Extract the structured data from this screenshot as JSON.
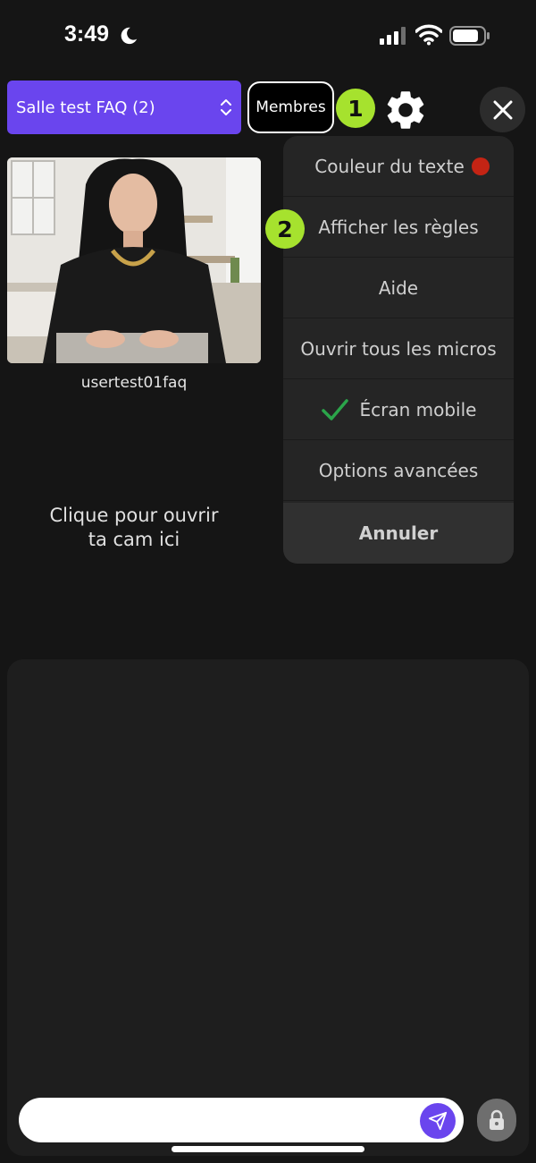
{
  "status_bar": {
    "time": "3:49"
  },
  "header": {
    "room_name": "Salle test FAQ (2)",
    "members_label": "Membres",
    "badge_1": "1",
    "badge_2": "2"
  },
  "video": {
    "username": "usertest01faq"
  },
  "cam_prompt": {
    "line1": "Clique pour ouvrir",
    "line2": "ta cam ici"
  },
  "menu": {
    "items": [
      {
        "label": "Couleur du texte",
        "color": "#c42414"
      },
      {
        "label": "Afficher les règles"
      },
      {
        "label": "Aide"
      },
      {
        "label": "Ouvrir tous les micros"
      },
      {
        "label": "Écran mobile",
        "checked": true
      },
      {
        "label": "Options avancées"
      }
    ],
    "cancel_label": "Annuler"
  },
  "chat": {
    "input_value": ""
  },
  "colors": {
    "accent": "#6a45ee",
    "badge": "#a6e22e",
    "check": "#2ba54a"
  }
}
